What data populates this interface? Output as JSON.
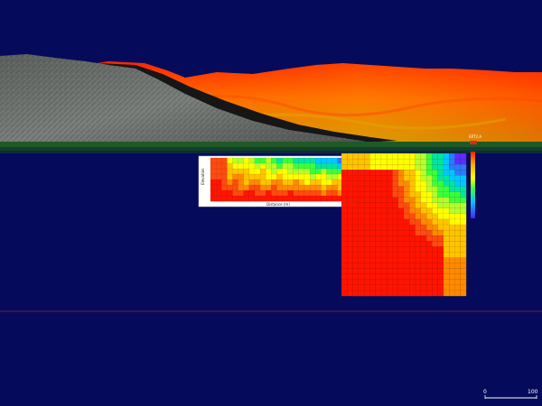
{
  "viewport": {
    "background": "#050b5a",
    "terrain_colors": [
      "#ff2200",
      "#ff8800",
      "#d4a000"
    ],
    "rock_color": "#6a6e6b"
  },
  "section": {
    "colormap": [
      "#ff1400",
      "#ff4a10",
      "#ff8a00",
      "#ffc400",
      "#ffff00",
      "#b6ff2a",
      "#3cff3c",
      "#00e6a0",
      "#00c8ff",
      "#2a7bff",
      "#5a2cff"
    ],
    "left_panel_axis_title": "Elevation",
    "left_panel_bottom_title": "Distance (m)"
  },
  "legend": {
    "tag": "ERT2.A"
  },
  "scale_bar": {
    "min_label": "0",
    "max_label": "100"
  }
}
